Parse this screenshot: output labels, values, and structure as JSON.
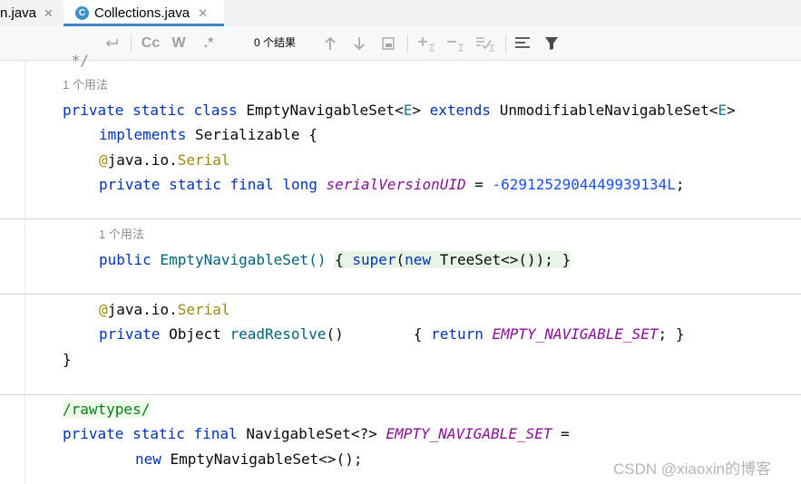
{
  "tabs": [
    {
      "label": "n.java",
      "close": "✕"
    },
    {
      "label": "Collections.java",
      "close": "✕",
      "icon_letter": "C",
      "active": true
    }
  ],
  "search": {
    "results": "0 个结果"
  },
  "toolbar": {
    "case_label": "Cc",
    "word_label": "W",
    "regex_label": ".*"
  },
  "code": {
    "l0": " */",
    "hint1": "1 个用法",
    "l1": [
      "private",
      "static",
      "class",
      "EmptyNavigableSet<",
      "E",
      "> ",
      "extends",
      " UnmodifiableNavigableSet<",
      "E",
      ">"
    ],
    "l2": [
      "implements",
      " Serializable {"
    ],
    "l3": [
      "@",
      "java.io.",
      "Serial"
    ],
    "l4": [
      "private",
      "static",
      "final",
      "long",
      "serialVersionUID",
      " = ",
      "-6291252904449939134L",
      ";"
    ],
    "hint2": "1 个用法",
    "l5": [
      "public",
      " EmptyNavigableSet() ",
      "{",
      " super",
      "(",
      "new",
      " TreeSet<>());",
      " }"
    ],
    "l6": [
      "@",
      "java.io.",
      "Serial"
    ],
    "l7": [
      "private",
      " Object ",
      "readResolve",
      "()",
      "{",
      "return",
      "EMPTY_NAVIGABLE_SET",
      "; }"
    ],
    "l8": "}",
    "l9": "/rawtypes/",
    "l10": [
      "private",
      "static",
      "final",
      " NavigableSet<?> ",
      "EMPTY_NAVIGABLE_SET",
      " ="
    ],
    "l11": [
      "new",
      " EmptyNavigableSet<>();"
    ]
  },
  "watermark": "CSDN @xiaoxin的博客"
}
